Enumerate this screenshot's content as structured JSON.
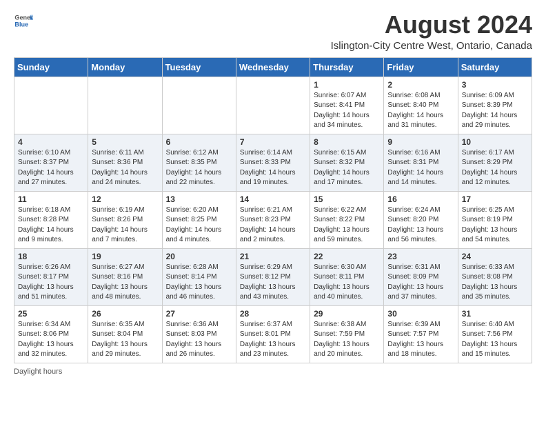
{
  "logo": {
    "general": "General",
    "blue": "Blue"
  },
  "title": "August 2024",
  "subtitle": "Islington-City Centre West, Ontario, Canada",
  "days_of_week": [
    "Sunday",
    "Monday",
    "Tuesday",
    "Wednesday",
    "Thursday",
    "Friday",
    "Saturday"
  ],
  "weeks": [
    [
      {
        "day": "",
        "info": ""
      },
      {
        "day": "",
        "info": ""
      },
      {
        "day": "",
        "info": ""
      },
      {
        "day": "",
        "info": ""
      },
      {
        "day": "1",
        "info": "Sunrise: 6:07 AM\nSunset: 8:41 PM\nDaylight: 14 hours\nand 34 minutes."
      },
      {
        "day": "2",
        "info": "Sunrise: 6:08 AM\nSunset: 8:40 PM\nDaylight: 14 hours\nand 31 minutes."
      },
      {
        "day": "3",
        "info": "Sunrise: 6:09 AM\nSunset: 8:39 PM\nDaylight: 14 hours\nand 29 minutes."
      }
    ],
    [
      {
        "day": "4",
        "info": "Sunrise: 6:10 AM\nSunset: 8:37 PM\nDaylight: 14 hours\nand 27 minutes."
      },
      {
        "day": "5",
        "info": "Sunrise: 6:11 AM\nSunset: 8:36 PM\nDaylight: 14 hours\nand 24 minutes."
      },
      {
        "day": "6",
        "info": "Sunrise: 6:12 AM\nSunset: 8:35 PM\nDaylight: 14 hours\nand 22 minutes."
      },
      {
        "day": "7",
        "info": "Sunrise: 6:14 AM\nSunset: 8:33 PM\nDaylight: 14 hours\nand 19 minutes."
      },
      {
        "day": "8",
        "info": "Sunrise: 6:15 AM\nSunset: 8:32 PM\nDaylight: 14 hours\nand 17 minutes."
      },
      {
        "day": "9",
        "info": "Sunrise: 6:16 AM\nSunset: 8:31 PM\nDaylight: 14 hours\nand 14 minutes."
      },
      {
        "day": "10",
        "info": "Sunrise: 6:17 AM\nSunset: 8:29 PM\nDaylight: 14 hours\nand 12 minutes."
      }
    ],
    [
      {
        "day": "11",
        "info": "Sunrise: 6:18 AM\nSunset: 8:28 PM\nDaylight: 14 hours\nand 9 minutes."
      },
      {
        "day": "12",
        "info": "Sunrise: 6:19 AM\nSunset: 8:26 PM\nDaylight: 14 hours\nand 7 minutes."
      },
      {
        "day": "13",
        "info": "Sunrise: 6:20 AM\nSunset: 8:25 PM\nDaylight: 14 hours\nand 4 minutes."
      },
      {
        "day": "14",
        "info": "Sunrise: 6:21 AM\nSunset: 8:23 PM\nDaylight: 14 hours\nand 2 minutes."
      },
      {
        "day": "15",
        "info": "Sunrise: 6:22 AM\nSunset: 8:22 PM\nDaylight: 13 hours\nand 59 minutes."
      },
      {
        "day": "16",
        "info": "Sunrise: 6:24 AM\nSunset: 8:20 PM\nDaylight: 13 hours\nand 56 minutes."
      },
      {
        "day": "17",
        "info": "Sunrise: 6:25 AM\nSunset: 8:19 PM\nDaylight: 13 hours\nand 54 minutes."
      }
    ],
    [
      {
        "day": "18",
        "info": "Sunrise: 6:26 AM\nSunset: 8:17 PM\nDaylight: 13 hours\nand 51 minutes."
      },
      {
        "day": "19",
        "info": "Sunrise: 6:27 AM\nSunset: 8:16 PM\nDaylight: 13 hours\nand 48 minutes."
      },
      {
        "day": "20",
        "info": "Sunrise: 6:28 AM\nSunset: 8:14 PM\nDaylight: 13 hours\nand 46 minutes."
      },
      {
        "day": "21",
        "info": "Sunrise: 6:29 AM\nSunset: 8:12 PM\nDaylight: 13 hours\nand 43 minutes."
      },
      {
        "day": "22",
        "info": "Sunrise: 6:30 AM\nSunset: 8:11 PM\nDaylight: 13 hours\nand 40 minutes."
      },
      {
        "day": "23",
        "info": "Sunrise: 6:31 AM\nSunset: 8:09 PM\nDaylight: 13 hours\nand 37 minutes."
      },
      {
        "day": "24",
        "info": "Sunrise: 6:33 AM\nSunset: 8:08 PM\nDaylight: 13 hours\nand 35 minutes."
      }
    ],
    [
      {
        "day": "25",
        "info": "Sunrise: 6:34 AM\nSunset: 8:06 PM\nDaylight: 13 hours\nand 32 minutes."
      },
      {
        "day": "26",
        "info": "Sunrise: 6:35 AM\nSunset: 8:04 PM\nDaylight: 13 hours\nand 29 minutes."
      },
      {
        "day": "27",
        "info": "Sunrise: 6:36 AM\nSunset: 8:03 PM\nDaylight: 13 hours\nand 26 minutes."
      },
      {
        "day": "28",
        "info": "Sunrise: 6:37 AM\nSunset: 8:01 PM\nDaylight: 13 hours\nand 23 minutes."
      },
      {
        "day": "29",
        "info": "Sunrise: 6:38 AM\nSunset: 7:59 PM\nDaylight: 13 hours\nand 20 minutes."
      },
      {
        "day": "30",
        "info": "Sunrise: 6:39 AM\nSunset: 7:57 PM\nDaylight: 13 hours\nand 18 minutes."
      },
      {
        "day": "31",
        "info": "Sunrise: 6:40 AM\nSunset: 7:56 PM\nDaylight: 13 hours\nand 15 minutes."
      }
    ]
  ],
  "footer": "Daylight hours"
}
